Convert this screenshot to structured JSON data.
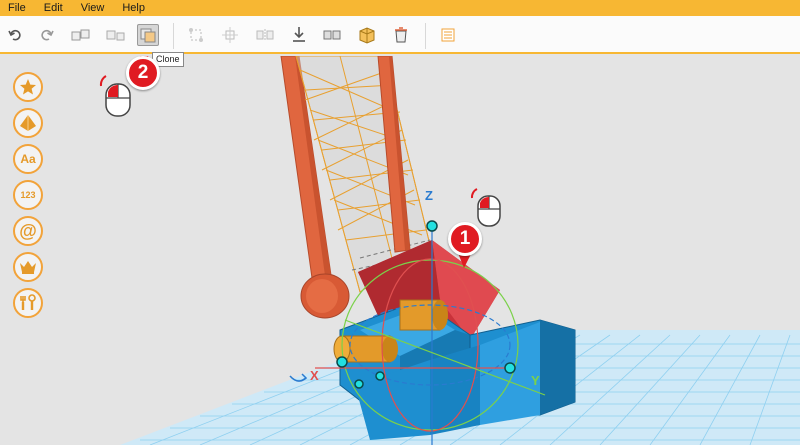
{
  "menu": [
    "File",
    "Edit",
    "View",
    "Help"
  ],
  "toolbar": {
    "tooltip": "Clone",
    "buttons": [
      "undo-icon",
      "redo-icon",
      "group-icon",
      "ungroup-icon",
      "clone-icon",
      "transform-icon",
      "align-icon",
      "mirror-icon",
      "drop-to-floor-icon",
      "split-icon",
      "combine-icon",
      "delete-icon",
      "settings-panel-icon"
    ]
  },
  "sidebar": {
    "buttons": [
      "star-icon",
      "shapes-icon",
      "text-icon",
      "numbers-icon",
      "symbols-icon",
      "crown-icon",
      "tools-icon"
    ],
    "text_label": "Aa",
    "number_label": "123",
    "symbol_label": "@"
  },
  "annotations": {
    "step1": "1",
    "step2": "2"
  },
  "gizmo": {
    "x_label": "X",
    "y_label": "Y",
    "z_label": "Z"
  },
  "colors": {
    "menubar": "#f7b733",
    "accent": "#f2a33a",
    "badge": "#e01b22",
    "model_blue": "#1e8fd0",
    "model_orange": "#e0663f"
  }
}
